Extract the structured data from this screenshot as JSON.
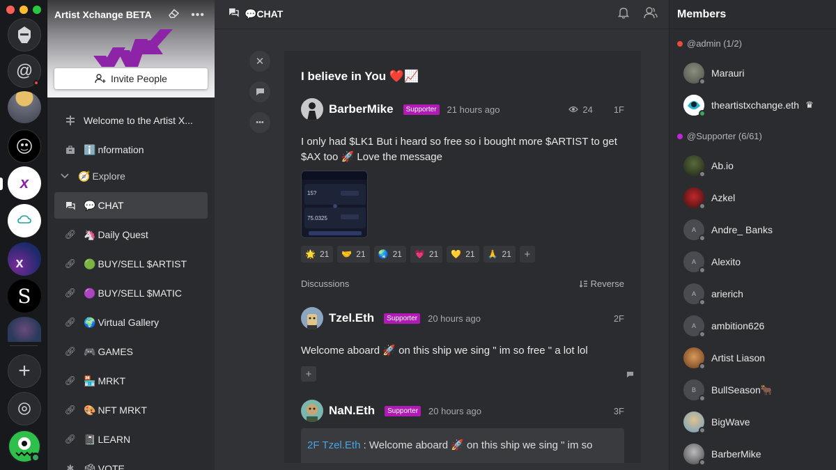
{
  "sidebar": {
    "server_name": "Artist Xchange BETA",
    "invite_label": "Invite People",
    "channels": [
      {
        "icon": "pin-icon",
        "emoji": "",
        "label": "Welcome to the Artist X..."
      },
      {
        "icon": "briefcase-icon",
        "emoji": "ℹ️",
        "label": "nformation"
      },
      {
        "icon": "chevron-down-icon",
        "emoji": "🧭",
        "label": "Explore"
      },
      {
        "icon": "chat-icon",
        "emoji": "💬",
        "label": "CHAT"
      },
      {
        "icon": "link-icon",
        "emoji": "🦄",
        "label": "Daily Quest"
      },
      {
        "icon": "link-icon",
        "emoji": "🟢",
        "label": "BUY/SELL $ARTIST"
      },
      {
        "icon": "link-icon",
        "emoji": "🟣",
        "label": "BUY/SELL $MATIC"
      },
      {
        "icon": "link-icon",
        "emoji": "🌍",
        "label": "Virtual Gallery"
      },
      {
        "icon": "link-icon",
        "emoji": "🎮",
        "label": "GAMES"
      },
      {
        "icon": "link-icon",
        "emoji": "🏪",
        "label": "MRKT"
      },
      {
        "icon": "link-icon",
        "emoji": "🎨",
        "label": "NFT MRKT"
      },
      {
        "icon": "link-icon",
        "emoji": "📓",
        "label": "LEARN"
      },
      {
        "icon": "puzzle-icon",
        "emoji": "🗳",
        "label": "VOTE"
      }
    ]
  },
  "header": {
    "emoji": "💬",
    "title": "CHAT"
  },
  "post": {
    "title": "I believe in You",
    "title_emoji": "❤️📈",
    "author": "BarberMike",
    "badge": "Supporter",
    "time": "21 hours ago",
    "views": "24",
    "floor": "1F",
    "body": "I only had $LK1 But i heard so free so i bought more $ARTIST to get $AX too 🚀 Love the message",
    "thumb": {
      "v1": "15?",
      "v2": "75.0325"
    },
    "reactions": [
      {
        "emoji": "🌟",
        "count": "21"
      },
      {
        "emoji": "🤝",
        "count": "21"
      },
      {
        "emoji": "🌏",
        "count": "21"
      },
      {
        "emoji": "💗",
        "count": "21"
      },
      {
        "emoji": "💛",
        "count": "21"
      },
      {
        "emoji": "🙏",
        "count": "21"
      }
    ]
  },
  "discussions": {
    "label": "Discussions",
    "reverse_label": "Reverse",
    "replies": [
      {
        "author": "Tzel.Eth",
        "badge": "Supporter",
        "time": "20 hours ago",
        "floor": "2F",
        "body": "Welcome aboard 🚀 on this ship we sing \" im so free \" a lot lol"
      },
      {
        "author": "NaN.Eth",
        "badge": "Supporter",
        "time": "20 hours ago",
        "floor": "3F",
        "quote_ref": "2F Tzel.Eth",
        "quote_text": " : Welcome aboard 🚀 on this ship we sing \" im so"
      }
    ]
  },
  "members": {
    "heading": "Members",
    "groups": [
      {
        "label": "@admin (1/2)",
        "color": "#e74c3c"
      },
      {
        "label": "@Supporter (6/61)",
        "color": "#c026d3"
      }
    ],
    "admins": [
      {
        "name": "Marauri"
      },
      {
        "name": "theartistxchange.eth"
      }
    ],
    "supporters": [
      {
        "name": "Ab.io"
      },
      {
        "name": "Azkel"
      },
      {
        "name": "Andre_ Banks",
        "letter": "A"
      },
      {
        "name": "Alexito",
        "letter": "A"
      },
      {
        "name": "arierich",
        "letter": "A"
      },
      {
        "name": "ambition626",
        "letter": "A"
      },
      {
        "name": "Artist Liason"
      },
      {
        "name": "BullSeason🐂",
        "letter": "B"
      },
      {
        "name": "BigWave"
      },
      {
        "name": "BarberMike"
      }
    ]
  }
}
